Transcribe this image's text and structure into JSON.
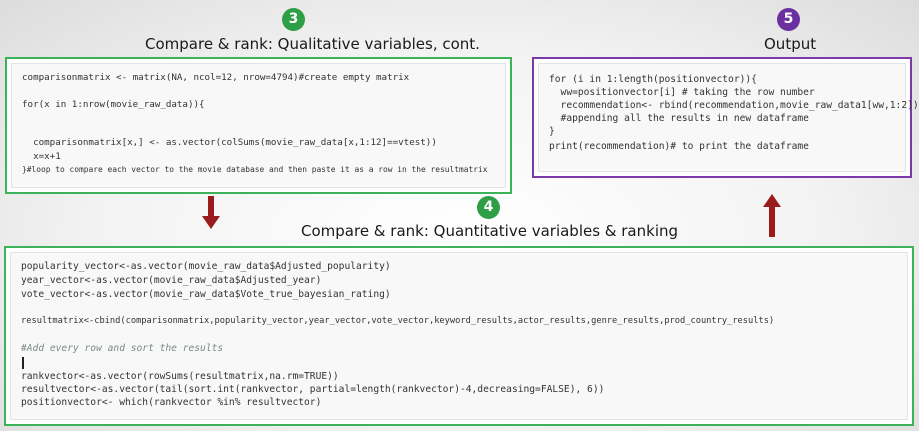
{
  "steps": {
    "s3": {
      "number": "3",
      "title": "Compare & rank: Qualitative variables, cont."
    },
    "s4": {
      "number": "4",
      "title": "Compare & rank: Quantitative variables & ranking"
    },
    "s5": {
      "number": "5",
      "title": "Output"
    }
  },
  "colors": {
    "green": "#2e9e47",
    "purple": "#6b2fa0",
    "arrow_red": "#9b1c1c"
  },
  "icons": {
    "down_arrow": "arrow-down-icon",
    "up_arrow": "arrow-up-icon"
  },
  "code": {
    "qualitative": [
      "comparisonmatrix <- matrix(NA, ncol=12, nrow=4794)#create empty matrix",
      "",
      "for(x in 1:nrow(movie_raw_data)){",
      "",
      "  comparisonmatrix[x,] <- as.vector(colSums(movie_raw_data[x,1:12]==vtest))",
      "  x=x+1",
      "}#loop to compare each vector to the movie database and then paste it as a row in the resultmatrix"
    ],
    "output": [
      "for (i in 1:length(positionvector)){",
      "  ww=positionvector[i] # taking the row number",
      "  recommendation<- rbind(recommendation,movie_raw_data1[ww,1:2])",
      "  #appending all the results in new dataframe",
      "}",
      "print(recommendation)# to print the dataframe"
    ],
    "quantitative": [
      "popularity_vector<-as.vector(movie_raw_data$Adjusted_popularity)",
      "year_vector<-as.vector(movie_raw_data$Adjusted_year)",
      "vote_vector<-as.vector(movie_raw_data$Vote_true_bayesian_rating)",
      "",
      "resultmatrix<-cbind(comparisonmatrix,popularity_vector,year_vector,vote_vector,keyword_results,actor_results,genre_results,prod_country_results)",
      "",
      "#Add every row and sort the results",
      "",
      "rankvector<-as.vector(rowSums(resultmatrix,na.rm=TRUE))",
      "resultvector<-as.vector(tail(sort.int(rankvector, partial=length(rankvector)-4,decreasing=FALSE), 6))",
      "positionvector<- which(rankvector %in% resultvector)"
    ]
  }
}
